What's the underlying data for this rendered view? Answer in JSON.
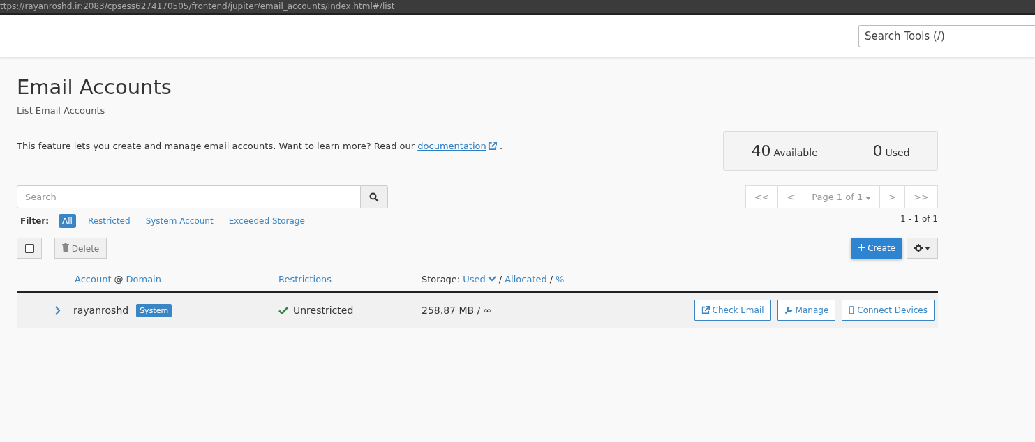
{
  "browser": {
    "url": "ttps://rayanroshd.ir:2083/cpsess6274170505/frontend/jupiter/email_accounts/index.html#/list"
  },
  "header": {
    "search": {
      "placeholder": "Search Tools (/)"
    }
  },
  "page": {
    "title": "Email Accounts",
    "subtitle": "List Email Accounts",
    "intro": "This feature lets you create and manage email accounts. Want to learn more? Read our",
    "intro_link": "documentation",
    "intro_end": "."
  },
  "stats": [
    {
      "value": "40",
      "label": "Available"
    },
    {
      "value": "0",
      "label": "Used"
    }
  ],
  "search": {
    "placeholder": "Search"
  },
  "filter": {
    "label": "Filter:",
    "options": [
      {
        "label": "All",
        "selected": true
      },
      {
        "label": "Restricted",
        "selected": false
      },
      {
        "label": "System Account",
        "selected": false
      },
      {
        "label": "Exceeded Storage",
        "selected": false
      }
    ]
  },
  "pagination": {
    "first": "<<",
    "prev": "<",
    "page": "Page 1 of 1",
    "next": ">",
    "last": ">>",
    "range": "1 - 1 of 1"
  },
  "toolbar": {
    "select_all_checked": false,
    "delete": "Delete",
    "create": "Create"
  },
  "table": {
    "columns": {
      "account": "Account",
      "at": "@",
      "domain": "Domain",
      "restrictions": "Restrictions",
      "storage": "Storage:",
      "used": "Used",
      "sep1": "/",
      "allocated": "Allocated",
      "sep2": "/",
      "percent": "%"
    },
    "rows": [
      {
        "account": "rayanroshd",
        "badge": "System",
        "restriction": "Unrestricted",
        "storage": "258.87 MB / ∞",
        "actions": [
          "Check Email",
          "Manage",
          "Connect Devices"
        ]
      }
    ]
  }
}
